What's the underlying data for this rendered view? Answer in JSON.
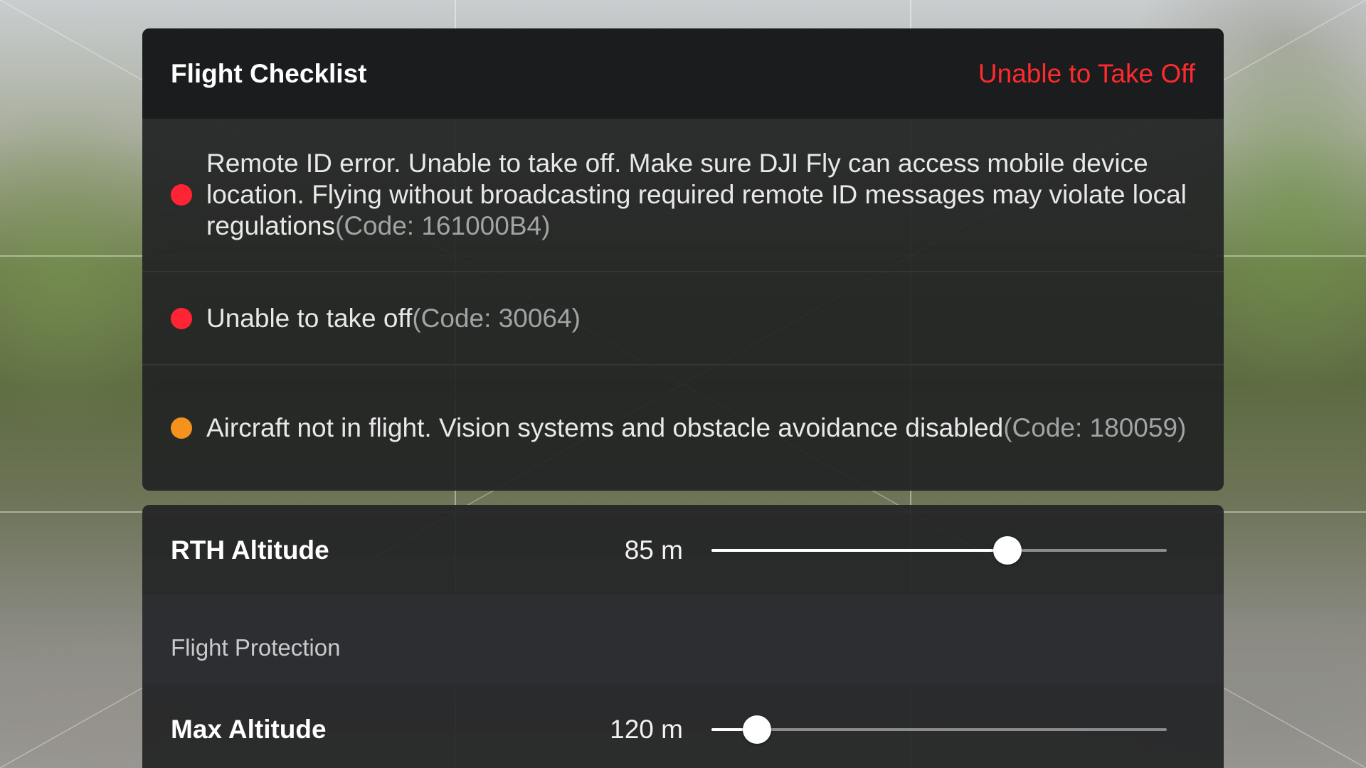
{
  "checklist": {
    "title": "Flight Checklist",
    "status": "Unable to Take Off",
    "status_color": "#ff2a2e",
    "items": [
      {
        "severity": "error",
        "dot_color": "#ff2434",
        "message": "Remote ID error. Unable to take off. Make sure DJI Fly can access mobile device location. Flying without broadcasting required remote ID messages may violate local regulations",
        "code": "(Code: 161000B4)"
      },
      {
        "severity": "error",
        "dot_color": "#ff2434",
        "message": "Unable to take off",
        "code": "(Code: 30064)"
      },
      {
        "severity": "warning",
        "dot_color": "#f5921e",
        "message": "Aircraft not in flight. Vision systems and obstacle avoidance disabled",
        "code": "(Code: 180059)"
      }
    ]
  },
  "settings": {
    "rth_altitude": {
      "label": "RTH Altitude",
      "value": "85 m",
      "slider_fraction": 0.65
    },
    "flight_protection": {
      "section_label": "Flight Protection"
    },
    "max_altitude": {
      "label": "Max Altitude",
      "value": "120 m",
      "slider_fraction": 0.1
    }
  }
}
